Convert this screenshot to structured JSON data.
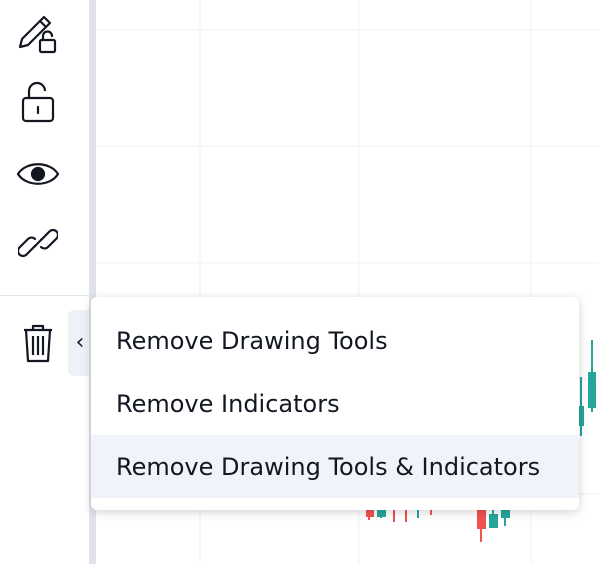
{
  "toolbar": {
    "tools": [
      {
        "icon": "pencil-lock-icon"
      },
      {
        "icon": "unlock-icon"
      },
      {
        "icon": "eye-icon"
      },
      {
        "icon": "link-icon"
      },
      {
        "icon": "trash-icon"
      }
    ],
    "collapse_glyph": "‹"
  },
  "menu": {
    "items": [
      {
        "label": "Remove Drawing Tools",
        "highlighted": false
      },
      {
        "label": "Remove Indicators",
        "highlighted": false
      },
      {
        "label": "Remove Drawing Tools & Indicators",
        "highlighted": true
      }
    ]
  },
  "colors": {
    "up": "#26a69a",
    "down": "#ef5350",
    "grid": "#eef0f4",
    "menu_highlight": "#f0f3fa"
  }
}
